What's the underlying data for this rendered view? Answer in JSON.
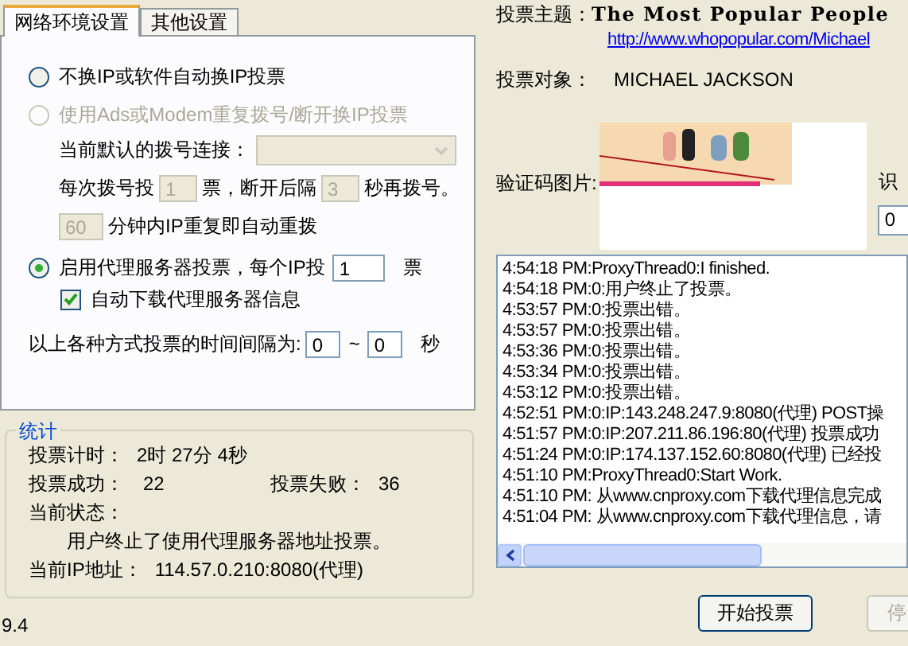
{
  "tabs": [
    {
      "label": "网络环境设置",
      "selected": true
    },
    {
      "label": "其他设置",
      "selected": false
    }
  ],
  "no_change_ip": {
    "label": "不换IP或软件自动换IP投票",
    "selected": false,
    "disabled": false
  },
  "dialup": {
    "label": "使用Ads或Modem重复拨号/断开换IP投票",
    "selected": false,
    "disabled": true,
    "connection_label": "当前默认的拨号连接：",
    "votes_prefix": "每次拨号投",
    "votes_value": "1",
    "votes_suffix": "票，断开后隔",
    "delay_value": "3",
    "delay_suffix": "秒再拨号。",
    "minutes_value": "60",
    "minutes_suffix": "分钟内IP重复即自动重拨"
  },
  "proxy": {
    "label": "启用代理服务器投票，每个IP投",
    "selected": true,
    "disabled": false,
    "votes_value": "1",
    "votes_suffix": "票",
    "auto_download": {
      "label": "自动下载代理服务器信息",
      "checked": true
    }
  },
  "interval": {
    "label": "以上各种方式投票的时间间隔为:",
    "from": "0",
    "separator": "~",
    "to": "0",
    "unit": "秒"
  },
  "stats": {
    "title": "统计",
    "timer_label": "投票计时：",
    "timer_value": "2时 27分 4秒",
    "success_label": "投票成功：",
    "success_value": "22",
    "fail_label": "投票失败：",
    "fail_value": "36",
    "status_label": "当前状态：",
    "status_value": "用户终止了使用代理服务器地址投票。",
    "ip_label": "当前IP地址：",
    "ip_value": "114.57.0.210:8080(代理)"
  },
  "version": "9.4",
  "topic": {
    "label": "投票主题：",
    "title": "The Most Popular People",
    "url": "http://www.whopopular.com/Michael"
  },
  "target": {
    "label": "投票对象：",
    "value": "MICHAEL JACKSON"
  },
  "captcha": {
    "label": "验证码图片:",
    "recognize_label": "识",
    "value": "0"
  },
  "log": [
    "4:54:18 PM:ProxyThread0:I finished.",
    "4:54:18 PM:0:用户终止了投票。",
    "4:53:57 PM:0:投票出错。",
    "4:53:57 PM:0:投票出错。",
    "4:53:36 PM:0:投票出错。",
    "4:53:34 PM:0:投票出错。",
    "4:53:12 PM:0:投票出错。",
    "4:52:51 PM:0:IP:143.248.247.9:8080(代理) POST操",
    "4:51:57 PM:0:IP:207.211.86.196:80(代理) 投票成功",
    "4:51:24 PM:0:IP:174.137.152.60:8080(代理) 已经投",
    "4:51:10 PM:ProxyThread0:Start Work.",
    "4:51:10 PM: 从www.cnproxy.com下载代理信息完成",
    "4:51:04 PM: 从www.cnproxy.com下载代理信息，请"
  ],
  "buttons": [
    {
      "label": "开始投票",
      "disabled": false
    },
    {
      "label": "停",
      "disabled": true
    }
  ]
}
